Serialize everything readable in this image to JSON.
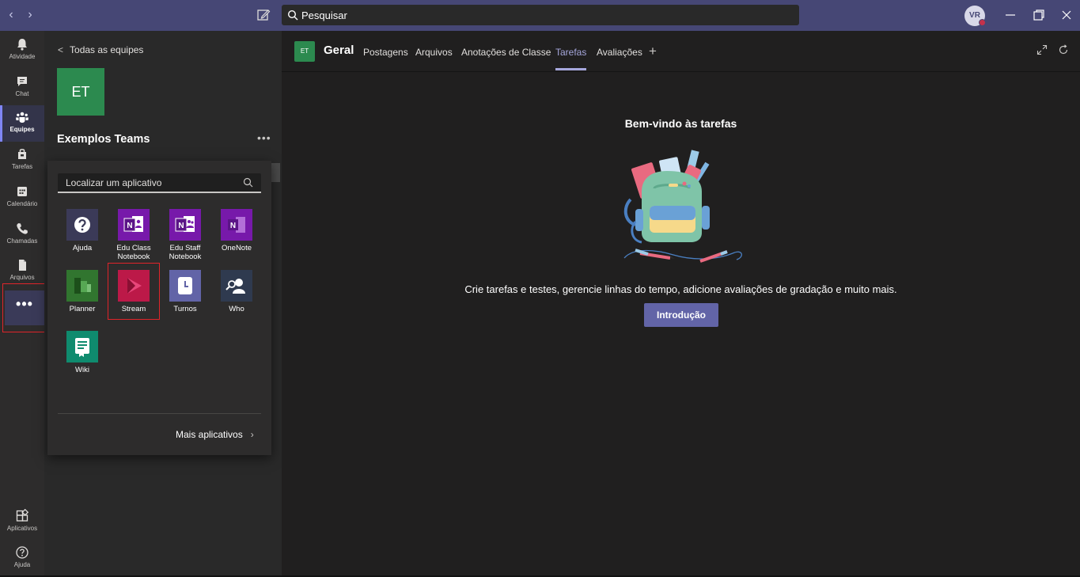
{
  "titlebar": {
    "search_placeholder": "Pesquisar",
    "avatar_initials": "VR"
  },
  "rail": {
    "items": [
      {
        "label": "Atividade",
        "icon": "bell-icon"
      },
      {
        "label": "Chat",
        "icon": "chat-icon"
      },
      {
        "label": "Equipes",
        "icon": "teams-icon",
        "active": true
      },
      {
        "label": "Tarefas",
        "icon": "assignments-icon"
      },
      {
        "label": "Calendário",
        "icon": "calendar-icon"
      },
      {
        "label": "Chamadas",
        "icon": "phone-icon"
      },
      {
        "label": "Arquivos",
        "icon": "file-icon"
      }
    ],
    "more": "•••",
    "apps_label": "Aplicativos",
    "help_label": "Ajuda"
  },
  "team": {
    "back_label": "Todas as equipes",
    "tile": "ET",
    "name": "Exemplos Teams",
    "more": "•••"
  },
  "flyout": {
    "search_placeholder": "Localizar um aplicativo",
    "apps": [
      {
        "label": "Ajuda",
        "icon": "help-icon",
        "color": "#3b3a58"
      },
      {
        "label": "Edu Class Notebook",
        "icon": "onenote-class-icon",
        "color": "#7719aa"
      },
      {
        "label": "Edu Staff Notebook",
        "icon": "onenote-staff-icon",
        "color": "#7719aa"
      },
      {
        "label": "OneNote",
        "icon": "onenote-icon",
        "color": "#7719aa"
      },
      {
        "label": "Planner",
        "icon": "planner-icon",
        "color": "#31752f"
      },
      {
        "label": "Stream",
        "icon": "stream-icon",
        "color": "#bc1948"
      },
      {
        "label": "Turnos",
        "icon": "shifts-icon",
        "color": "#6264a7"
      },
      {
        "label": "Who",
        "icon": "who-icon",
        "color": "#2f3a4f"
      },
      {
        "label": "Wiki",
        "icon": "wiki-icon",
        "color": "#0f8b6e"
      }
    ],
    "more_apps": "Mais aplicativos"
  },
  "channel": {
    "tile": "ET",
    "name": "Geral",
    "tabs": [
      "Postagens",
      "Arquivos",
      "Anotações de Classe",
      "Tarefas",
      "Avaliações"
    ],
    "active_tab": "Tarefas",
    "add_tab": "+"
  },
  "welcome": {
    "title": "Bem-vindo às tarefas",
    "description": "Crie tarefas e testes, gerencie linhas do tempo, adicione avaliações de gradação e muito mais.",
    "button": "Introdução"
  },
  "colors": {
    "accent": "#6264a7",
    "titlebar": "#464775",
    "highlight": "#e0242a"
  }
}
